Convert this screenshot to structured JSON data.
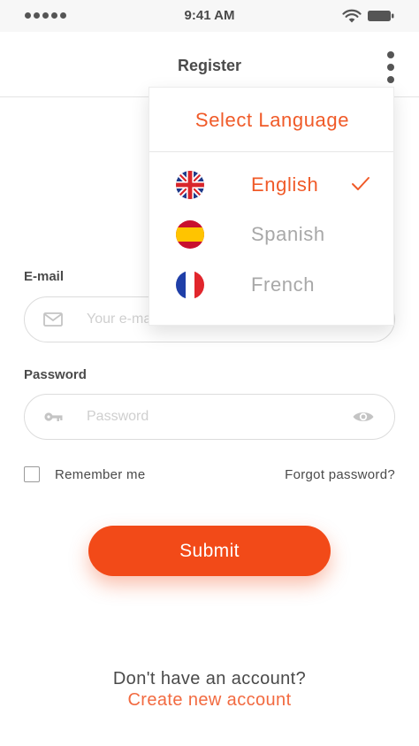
{
  "status_bar": {
    "time": "9:41 AM"
  },
  "nav": {
    "title": "Register"
  },
  "form": {
    "email_label": "E-mail",
    "email_placeholder": "Your e-mail",
    "password_label": "Password",
    "password_placeholder": "Password",
    "remember_label": "Remember me",
    "remember_checked": false,
    "forgot_label": "Forgot password?",
    "submit_label": "Submit"
  },
  "footer": {
    "prompt": "Don't have an account?",
    "link": "Create new account"
  },
  "language_menu": {
    "title": "Select Language",
    "selected": "English",
    "items": [
      {
        "label": "English",
        "flag": "uk-flag-icon"
      },
      {
        "label": "Spanish",
        "flag": "spain-flag-icon"
      },
      {
        "label": "French",
        "flag": "france-flag-icon"
      }
    ]
  },
  "colors": {
    "accent": "#f24a18",
    "accent_text": "#f05a28",
    "text": "#4a4a4a",
    "muted": "#a8a8a8"
  }
}
